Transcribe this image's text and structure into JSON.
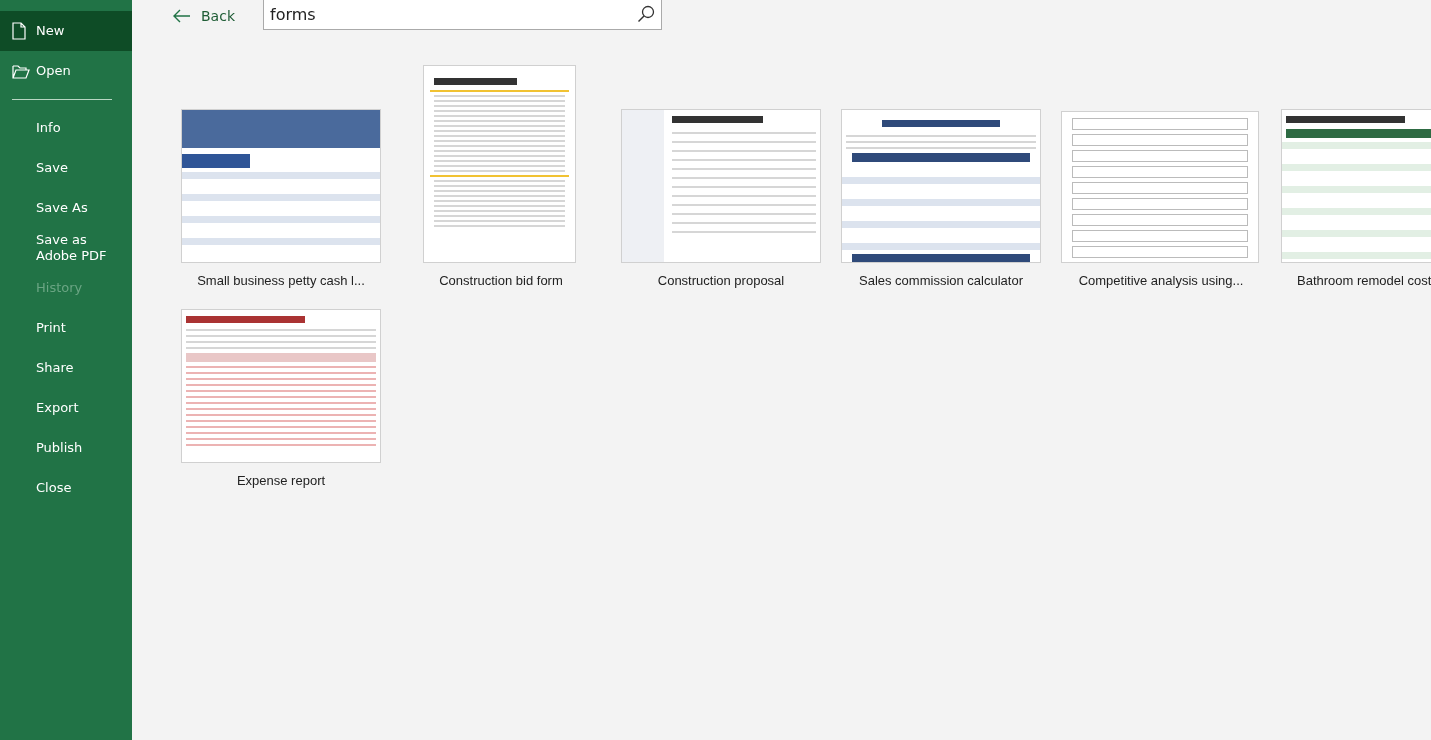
{
  "sidebar": {
    "items": [
      {
        "label": "New",
        "selected": true,
        "disabled": false
      },
      {
        "label": "Open",
        "selected": false,
        "disabled": false
      },
      {
        "kind": "divider"
      },
      {
        "label": "Info",
        "selected": false,
        "disabled": false
      },
      {
        "label": "Save",
        "selected": false,
        "disabled": false
      },
      {
        "label": "Save As",
        "selected": false,
        "disabled": false
      },
      {
        "label": "Save as Adobe PDF",
        "selected": false,
        "disabled": false
      },
      {
        "label": "History",
        "selected": false,
        "disabled": true
      },
      {
        "label": "Print",
        "selected": false,
        "disabled": false
      },
      {
        "label": "Share",
        "selected": false,
        "disabled": false
      },
      {
        "label": "Export",
        "selected": false,
        "disabled": false
      },
      {
        "label": "Publish",
        "selected": false,
        "disabled": false
      },
      {
        "label": "Close",
        "selected": false,
        "disabled": false
      }
    ]
  },
  "back": {
    "label": "Back"
  },
  "search": {
    "value": "forms"
  },
  "templates": [
    {
      "label": "Small business petty cash l...",
      "cut": false
    },
    {
      "label": "Construction bid form",
      "cut": false
    },
    {
      "label": "Construction proposal",
      "cut": false
    },
    {
      "label": "Sales commission calculator",
      "cut": false
    },
    {
      "label": "Competitive analysis using...",
      "cut": false
    },
    {
      "label": "Bathroom remodel cost",
      "cut": true
    },
    {
      "label": "Expense report",
      "cut": false
    }
  ]
}
